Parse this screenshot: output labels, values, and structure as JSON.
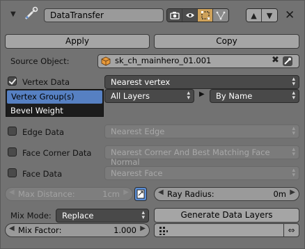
{
  "header": {
    "collapse_icon": "triangle-down",
    "modifier_icon": "wrench-icon",
    "name": "DataTransfer",
    "close_icon": "x-icon"
  },
  "toolbar": {
    "apply_label": "Apply",
    "copy_label": "Copy"
  },
  "source": {
    "label": "Source Object:",
    "value": "sk_ch_mainhero_01.001"
  },
  "vertex": {
    "label": "Vertex Data",
    "checked": true,
    "mapping": "Nearest vertex",
    "layers": "All Layers",
    "match": "By Name",
    "popup_items": [
      "Vertex Group(s)",
      "Bevel Weight"
    ]
  },
  "edge": {
    "label": "Edge Data",
    "mapping": "Nearest Edge"
  },
  "face_corner": {
    "label": "Face Corner Data",
    "mapping": "Nearest Corner And Best Matching Face Normal"
  },
  "face": {
    "label": "Face Data",
    "mapping": "Nearest Face"
  },
  "max_distance": {
    "label": "Max Distance:",
    "value": "1cm"
  },
  "ray_radius": {
    "label": "Ray Radius:",
    "value": "0m"
  },
  "mix_mode": {
    "label": "Mix Mode:",
    "value": "Replace"
  },
  "generate_label": "Generate Data Layers",
  "mix_factor": {
    "label": "Mix Factor:",
    "value": "1.000"
  },
  "colors": {
    "panel": "#727272",
    "selection": "#5680c2",
    "dropdown": "#494949"
  }
}
